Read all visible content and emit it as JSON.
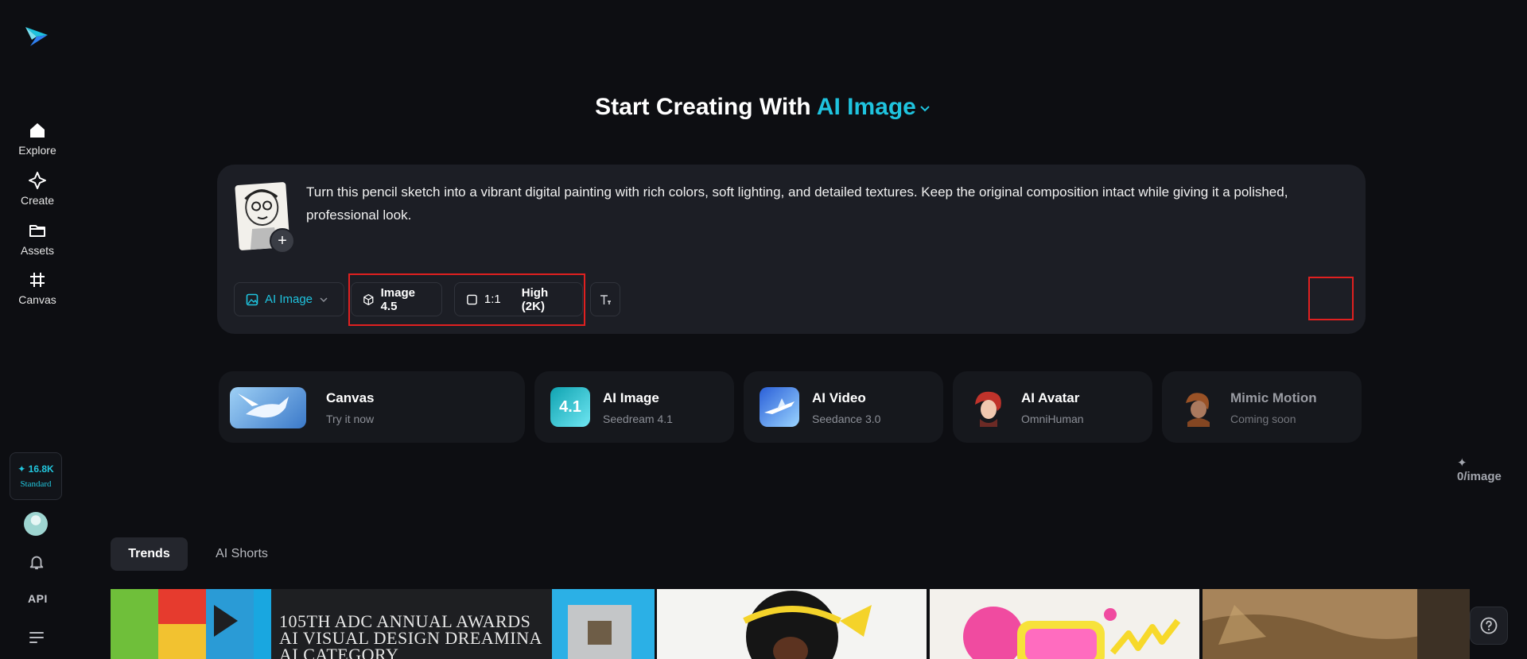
{
  "sidebar": {
    "items": [
      {
        "label": "Explore",
        "icon": "home-icon"
      },
      {
        "label": "Create",
        "icon": "sparkle-icon"
      },
      {
        "label": "Assets",
        "icon": "folder-icon"
      },
      {
        "label": "Canvas",
        "icon": "frame-icon"
      }
    ],
    "credits": {
      "amount": "16.8K",
      "plan": "Standard"
    },
    "api_label": "API"
  },
  "heading": {
    "prefix": "Start Creating With",
    "accent": "AI Image"
  },
  "prompt": {
    "text": "Turn this pencil sketch into a vibrant digital painting with rich colors, soft lighting, and detailed textures. Keep the original composition intact while giving it a polished, professional look.",
    "mode_label": "AI Image",
    "model_label": "Image 4.5",
    "ratio_label": "1:1",
    "quality_label": "High (2K)",
    "cost_label": "0/image"
  },
  "tools": [
    {
      "title": "Canvas",
      "subtitle": "Try it now"
    },
    {
      "title": "AI Image",
      "subtitle": "Seedream 4.1",
      "badge": "4.1"
    },
    {
      "title": "AI Video",
      "subtitle": "Seedance 3.0"
    },
    {
      "title": "AI Avatar",
      "subtitle": "OmniHuman"
    },
    {
      "title": "Mimic Motion",
      "subtitle": "Coming soon"
    }
  ],
  "tabs": [
    {
      "label": "Trends"
    },
    {
      "label": "AI Shorts"
    }
  ],
  "gallery": [
    {
      "caption": "105TH ADC ANNUAL AWARDS AI VISUAL DESIGN DREAMINA AI CATEGORY"
    }
  ],
  "colors": {
    "accent": "#1fc3de",
    "background": "#0d0e12",
    "card": "#1c1e25",
    "highlight": "#e02020"
  }
}
